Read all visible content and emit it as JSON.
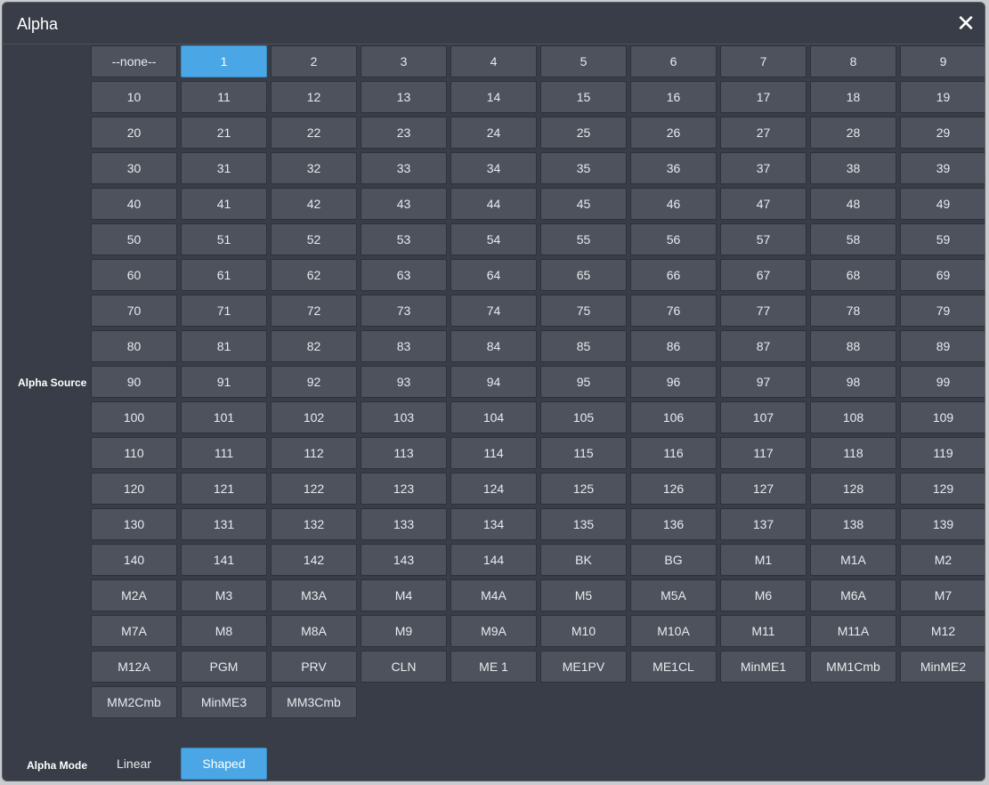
{
  "dialog": {
    "title": "Alpha"
  },
  "labels": {
    "alpha_source": "Alpha Source",
    "alpha_mode": "Alpha Mode"
  },
  "alpha_source": {
    "selected": "1",
    "options": [
      "--none--",
      "1",
      "2",
      "3",
      "4",
      "5",
      "6",
      "7",
      "8",
      "9",
      "10",
      "11",
      "12",
      "13",
      "14",
      "15",
      "16",
      "17",
      "18",
      "19",
      "20",
      "21",
      "22",
      "23",
      "24",
      "25",
      "26",
      "27",
      "28",
      "29",
      "30",
      "31",
      "32",
      "33",
      "34",
      "35",
      "36",
      "37",
      "38",
      "39",
      "40",
      "41",
      "42",
      "43",
      "44",
      "45",
      "46",
      "47",
      "48",
      "49",
      "50",
      "51",
      "52",
      "53",
      "54",
      "55",
      "56",
      "57",
      "58",
      "59",
      "60",
      "61",
      "62",
      "63",
      "64",
      "65",
      "66",
      "67",
      "68",
      "69",
      "70",
      "71",
      "72",
      "73",
      "74",
      "75",
      "76",
      "77",
      "78",
      "79",
      "80",
      "81",
      "82",
      "83",
      "84",
      "85",
      "86",
      "87",
      "88",
      "89",
      "90",
      "91",
      "92",
      "93",
      "94",
      "95",
      "96",
      "97",
      "98",
      "99",
      "100",
      "101",
      "102",
      "103",
      "104",
      "105",
      "106",
      "107",
      "108",
      "109",
      "110",
      "111",
      "112",
      "113",
      "114",
      "115",
      "116",
      "117",
      "118",
      "119",
      "120",
      "121",
      "122",
      "123",
      "124",
      "125",
      "126",
      "127",
      "128",
      "129",
      "130",
      "131",
      "132",
      "133",
      "134",
      "135",
      "136",
      "137",
      "138",
      "139",
      "140",
      "141",
      "142",
      "143",
      "144",
      "BK",
      "BG",
      "M1",
      "M1A",
      "M2",
      "M2A",
      "M3",
      "M3A",
      "M4",
      "M4A",
      "M5",
      "M5A",
      "M6",
      "M6A",
      "M7",
      "M7A",
      "M8",
      "M8A",
      "M9",
      "M9A",
      "M10",
      "M10A",
      "M11",
      "M11A",
      "M12",
      "M12A",
      "PGM",
      "PRV",
      "CLN",
      "ME 1",
      "ME1PV",
      "ME1CL",
      "MinME1",
      "MM1Cmb",
      "MinME2",
      "MM2Cmb",
      "MinME3",
      "MM3Cmb"
    ]
  },
  "alpha_mode": {
    "selected": "Shaped",
    "options": [
      "Linear",
      "Shaped"
    ]
  },
  "colors": {
    "selected": "#4aa6e4",
    "button": "#4d525d",
    "background": "#383d47"
  }
}
